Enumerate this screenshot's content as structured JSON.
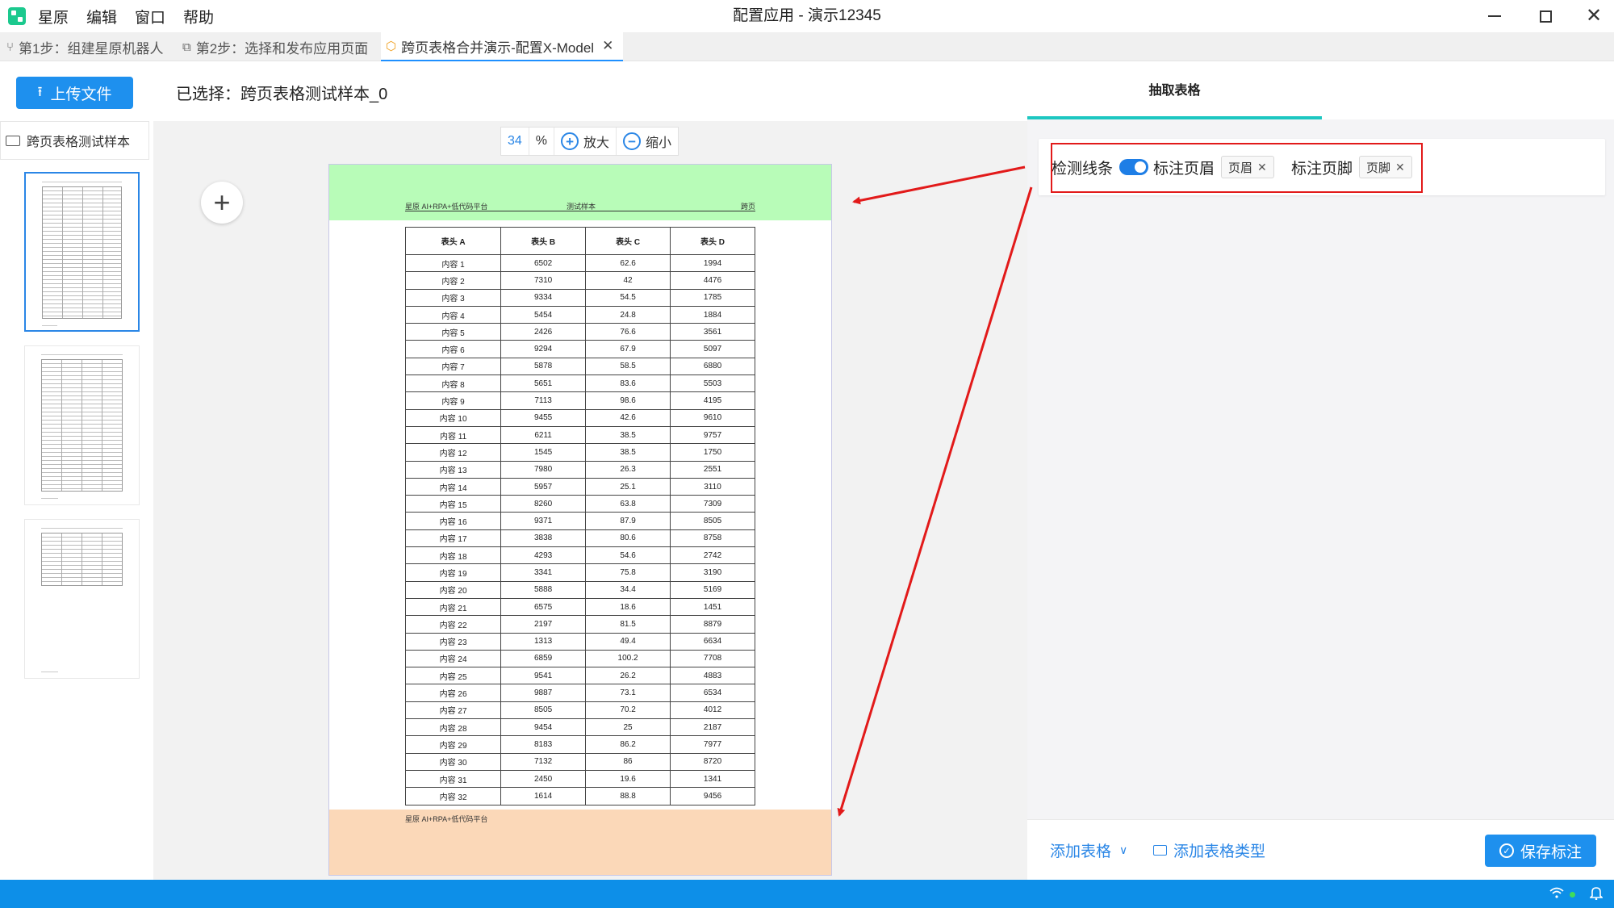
{
  "app": {
    "menu": [
      "星原",
      "编辑",
      "窗口",
      "帮助"
    ],
    "window_title": "配置应用 - 演示12345"
  },
  "tabs": [
    {
      "label": "第1步：组建星原机器人",
      "icon": "branch-icon"
    },
    {
      "label": "第2步：选择和发布应用页面",
      "icon": "app-page-icon"
    },
    {
      "label": "跨页表格合并演示-配置X-Model",
      "icon": "cube-icon",
      "active": true
    }
  ],
  "toolbar": {
    "upload_label": "上传文件",
    "selected_text": "已选择：跨页表格测试样本_0"
  },
  "files": {
    "name": "跨页表格测试样本",
    "pages": 3,
    "active_page": 1
  },
  "zoom": {
    "value": "34",
    "unit": "%",
    "zoom_in": "放大",
    "zoom_out": "缩小"
  },
  "document": {
    "header_left": "星原 AI+RPA+低代码平台",
    "header_center": "测试样本",
    "header_right": "跨页",
    "footer_left": "星原 AI+RPA+低代码平台",
    "columns": [
      "表头 A",
      "表头 B",
      "表头 C",
      "表头 D"
    ],
    "rows": [
      [
        "内容 1",
        "6502",
        "62.6",
        "1994"
      ],
      [
        "内容 2",
        "7310",
        "42",
        "4476"
      ],
      [
        "内容 3",
        "9334",
        "54.5",
        "1785"
      ],
      [
        "内容 4",
        "5454",
        "24.8",
        "1884"
      ],
      [
        "内容 5",
        "2426",
        "76.6",
        "3561"
      ],
      [
        "内容 6",
        "9294",
        "67.9",
        "5097"
      ],
      [
        "内容 7",
        "5878",
        "58.5",
        "6880"
      ],
      [
        "内容 8",
        "5651",
        "83.6",
        "5503"
      ],
      [
        "内容 9",
        "7113",
        "98.6",
        "4195"
      ],
      [
        "内容 10",
        "9455",
        "42.6",
        "9610"
      ],
      [
        "内容 11",
        "6211",
        "38.5",
        "9757"
      ],
      [
        "内容 12",
        "1545",
        "38.5",
        "1750"
      ],
      [
        "内容 13",
        "7980",
        "26.3",
        "2551"
      ],
      [
        "内容 14",
        "5957",
        "25.1",
        "3110"
      ],
      [
        "内容 15",
        "8260",
        "63.8",
        "7309"
      ],
      [
        "内容 16",
        "9371",
        "87.9",
        "8505"
      ],
      [
        "内容 17",
        "3838",
        "80.6",
        "8758"
      ],
      [
        "内容 18",
        "4293",
        "54.6",
        "2742"
      ],
      [
        "内容 19",
        "3341",
        "75.8",
        "3190"
      ],
      [
        "内容 20",
        "5888",
        "34.4",
        "5169"
      ],
      [
        "内容 21",
        "6575",
        "18.6",
        "1451"
      ],
      [
        "内容 22",
        "2197",
        "81.5",
        "8879"
      ],
      [
        "内容 23",
        "1313",
        "49.4",
        "6634"
      ],
      [
        "内容 24",
        "6859",
        "100.2",
        "7708"
      ],
      [
        "内容 25",
        "9541",
        "26.2",
        "4883"
      ],
      [
        "内容 26",
        "9887",
        "73.1",
        "6534"
      ],
      [
        "内容 27",
        "8505",
        "70.2",
        "4012"
      ],
      [
        "内容 28",
        "9454",
        "25",
        "2187"
      ],
      [
        "内容 29",
        "8183",
        "86.2",
        "7977"
      ],
      [
        "内容 30",
        "7132",
        "86",
        "8720"
      ],
      [
        "内容 31",
        "2450",
        "19.6",
        "1341"
      ],
      [
        "内容 32",
        "1614",
        "88.8",
        "9456"
      ]
    ]
  },
  "right_panel": {
    "tab_label": "抽取表格",
    "detect_lines_label": "检测线条",
    "detect_lines_on": true,
    "mark_header_label": "标注页眉",
    "header_tag": "页眉",
    "mark_footer_label": "标注页脚",
    "footer_tag": "页脚",
    "add_table_label": "添加表格",
    "add_table_type_label": "添加表格类型",
    "save_label": "保存标注"
  },
  "colors": {
    "accent": "#1e90ee",
    "header_zone": "#b8fcb8",
    "footer_zone": "#fbd8b8",
    "highlight": "#e21a1a",
    "tab_underline": "#1dc7c1",
    "statusbar": "#0d8fe8"
  }
}
